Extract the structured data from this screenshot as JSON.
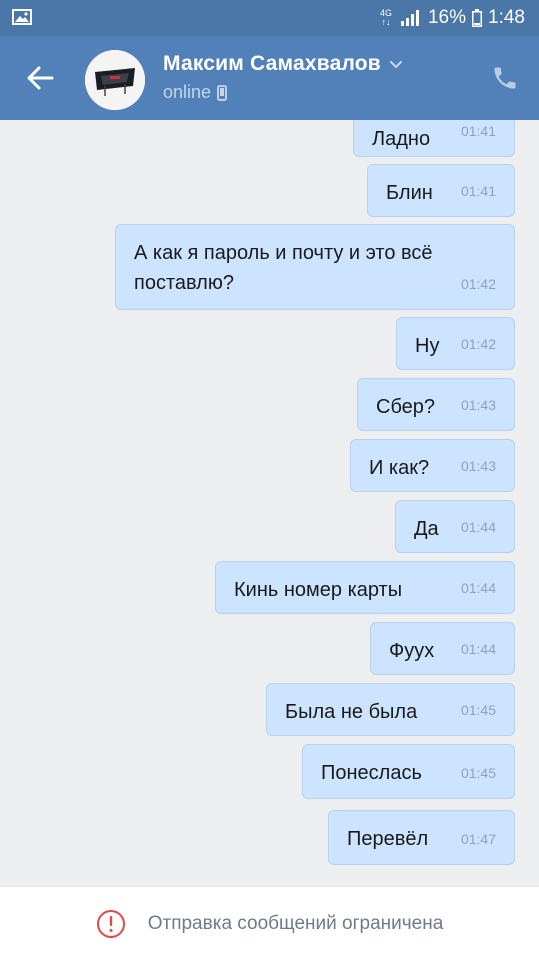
{
  "status_bar": {
    "network": "4G",
    "network_sub": "↑↓",
    "battery": "16%",
    "time": "1:48"
  },
  "header": {
    "contact_name": "Максим Самахвалов",
    "presence": "online"
  },
  "messages": [
    {
      "text": "Ладно",
      "time": "01:41"
    },
    {
      "text": "Блин",
      "time": "01:41"
    },
    {
      "text": "А как я пароль и почту и это всё поставлю?",
      "time": "01:42"
    },
    {
      "text": "Ну",
      "time": "01:42"
    },
    {
      "text": "Сбер?",
      "time": "01:43"
    },
    {
      "text": "И как?",
      "time": "01:43"
    },
    {
      "text": "Да",
      "time": "01:44"
    },
    {
      "text": "Кинь номер карты",
      "time": "01:44"
    },
    {
      "text": "Фуух",
      "time": "01:44"
    },
    {
      "text": "Была не была",
      "time": "01:45"
    },
    {
      "text": "Понеслась",
      "time": "01:45"
    },
    {
      "text": "Перевёл",
      "time": "01:47"
    }
  ],
  "footer": {
    "notice": "Отправка сообщений ограничена"
  },
  "colors": {
    "header": "#5181b8",
    "status_bar": "#4a76a8",
    "bubble": "#cce4ff",
    "background": "#edeef0",
    "warning": "#e64646"
  }
}
